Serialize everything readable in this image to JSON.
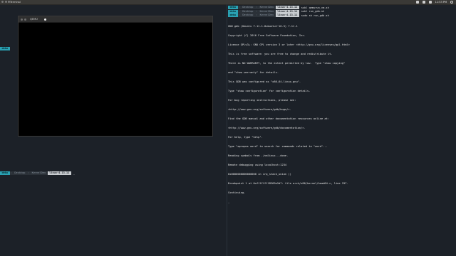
{
  "topbar": {
    "title": "Terminal",
    "clock": "11:53 PM"
  },
  "prompts": {
    "right": [
      {
        "user": "deku",
        "dir1": "Desktop",
        "dir2": "KernelDev",
        "cur": "linux-4.13.11",
        "cmd": "subl qemurun_vm.sh"
      },
      {
        "user": "deku",
        "dir1": "Desktop",
        "dir2": "KernelDev",
        "cur": "linux-4.13.11",
        "cmd": "subl run_gdb.sh"
      },
      {
        "user": "deku",
        "dir1": "Desktop",
        "dir2": "KernelDev",
        "cur": "linux-4.13.11",
        "cmd": "sudo sh run_gdb.sh"
      }
    ],
    "bottom": {
      "user": "deku",
      "dir1": "Desktop",
      "dir2": "KernelDev",
      "cur": "linux-4.13.11",
      "cmd": ""
    },
    "mini": {
      "user": "deku"
    }
  },
  "qemu": {
    "title": "QEMU"
  },
  "gdb_lines": [
    "GNU gdb (Ubuntu 7.11.1-0ubuntu1~16.5) 7.11.1",
    "Copyright (C) 2016 Free Software Foundation, Inc.",
    "License GPLv3+: GNU GPL version 3 or later <http://gnu.org/licenses/gpl.html>",
    "This is free software: you are free to change and redistribute it.",
    "There is NO WARRANTY, to the extent permitted by law.  Type \"show copying\"",
    "and \"show warranty\" for details.",
    "This GDB was configured as \"x86_64-linux-gnu\".",
    "Type \"show configuration\" for configuration details.",
    "For bug reporting instructions, please see:",
    "<http://www.gnu.org/software/gdb/bugs/>.",
    "Find the GDB manual and other documentation resources online at:",
    "<http://www.gnu.org/software/gdb/documentation/>.",
    "For help, type \"help\".",
    "Type \"apropos word\" to search for commands related to \"word\"...",
    "Reading symbols from ./vmlinux...done.",
    "Remote debugging using localhost:1234",
    "0x0000000000000000 in irq_stack_union ()",
    "Breakpoint 1 at 0xffffffff8269e2d7: file arch/x86/kernel/head64.c, line 257.",
    "Continuing.",
    "_"
  ]
}
